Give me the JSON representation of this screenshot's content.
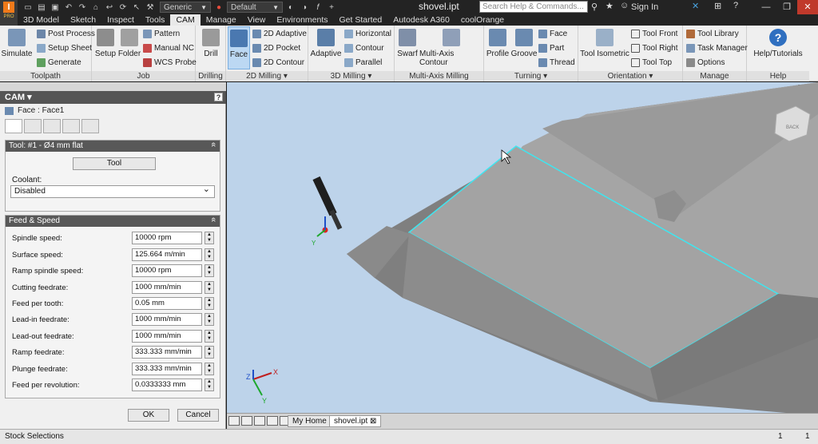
{
  "title": {
    "app_letter": "I",
    "app_edition": "PRO",
    "document": "shovel.ipt",
    "material_dropdown": "Generic",
    "appearance_dropdown": "Default",
    "search_placeholder": "Search Help & Commands...",
    "signin": "Sign In"
  },
  "tabs": [
    "3D Model",
    "Sketch",
    "Inspect",
    "Tools",
    "CAM",
    "Manage",
    "View",
    "Environments",
    "Get Started",
    "Autodesk A360",
    "coolOrange"
  ],
  "ribbon": {
    "toolpath": {
      "label": "Toolpath",
      "simulate": "Simulate",
      "post_process": "Post Process",
      "setup_sheet": "Setup Sheet",
      "generate": "Generate"
    },
    "job": {
      "label": "Job",
      "setup": "Setup",
      "folder": "Folder",
      "pattern": "Pattern",
      "manual_nc": "Manual NC",
      "wcs_probe": "WCS Probe"
    },
    "drilling": {
      "label": "Drilling",
      "drill": "Drill"
    },
    "milling2d": {
      "label": "2D Milling ▾",
      "face": "Face",
      "adaptive": "2D Adaptive",
      "pocket": "2D Pocket",
      "contour": "2D Contour"
    },
    "milling3d": {
      "label": "3D Milling ▾",
      "adaptive": "Adaptive",
      "horizontal": "Horizontal",
      "contour": "Contour",
      "parallel": "Parallel"
    },
    "multiaxis": {
      "label": "Multi-Axis Milling",
      "swarf": "Swarf",
      "contour": "Multi-Axis Contour"
    },
    "turning": {
      "label": "Turning ▾",
      "profile": "Profile",
      "groove": "Groove",
      "face": "Face",
      "part": "Part",
      "thread": "Thread"
    },
    "orientation": {
      "label": "Orientation ▾",
      "isometric": "Tool Isometric",
      "front": "Tool Front",
      "right": "Tool Right",
      "top": "Tool Top"
    },
    "manage": {
      "label": "Manage",
      "library": "Tool Library",
      "task": "Task Manager",
      "options": "Options"
    },
    "help": {
      "label": "Help",
      "tutorials": "Help/Tutorials"
    }
  },
  "panel": {
    "header": "CAM ▾",
    "help_icon": "?",
    "operation": "Face : Face1",
    "tool_section": "Tool: #1 - Ø4 mm flat",
    "tool_button": "Tool",
    "coolant_label": "Coolant:",
    "coolant_value": "Disabled",
    "feed_section": "Feed & Speed",
    "fields": [
      {
        "label": "Spindle speed:",
        "value": "10000 rpm"
      },
      {
        "label": "Surface speed:",
        "value": "125.664 m/min"
      },
      {
        "label": "Ramp spindle speed:",
        "value": "10000 rpm"
      },
      {
        "label": "Cutting feedrate:",
        "value": "1000 mm/min"
      },
      {
        "label": "Feed per tooth:",
        "value": "0.05 mm"
      },
      {
        "label": "Lead-in feedrate:",
        "value": "1000 mm/min"
      },
      {
        "label": "Lead-out feedrate:",
        "value": "1000 mm/min"
      },
      {
        "label": "Ramp feedrate:",
        "value": "333.333 mm/min"
      },
      {
        "label": "Plunge feedrate:",
        "value": "333.333 mm/min"
      },
      {
        "label": "Feed per revolution:",
        "value": "0.0333333 mm"
      }
    ],
    "ok": "OK",
    "cancel": "Cancel"
  },
  "viewport": {
    "viewcube_label": "BACK",
    "axis_x": "X",
    "axis_y": "Y",
    "axis_z": "Z"
  },
  "doc_tabs": [
    "My Home",
    "shovel.ipt"
  ],
  "status": {
    "text": "Stock Selections",
    "n1": "1",
    "n2": "1"
  }
}
